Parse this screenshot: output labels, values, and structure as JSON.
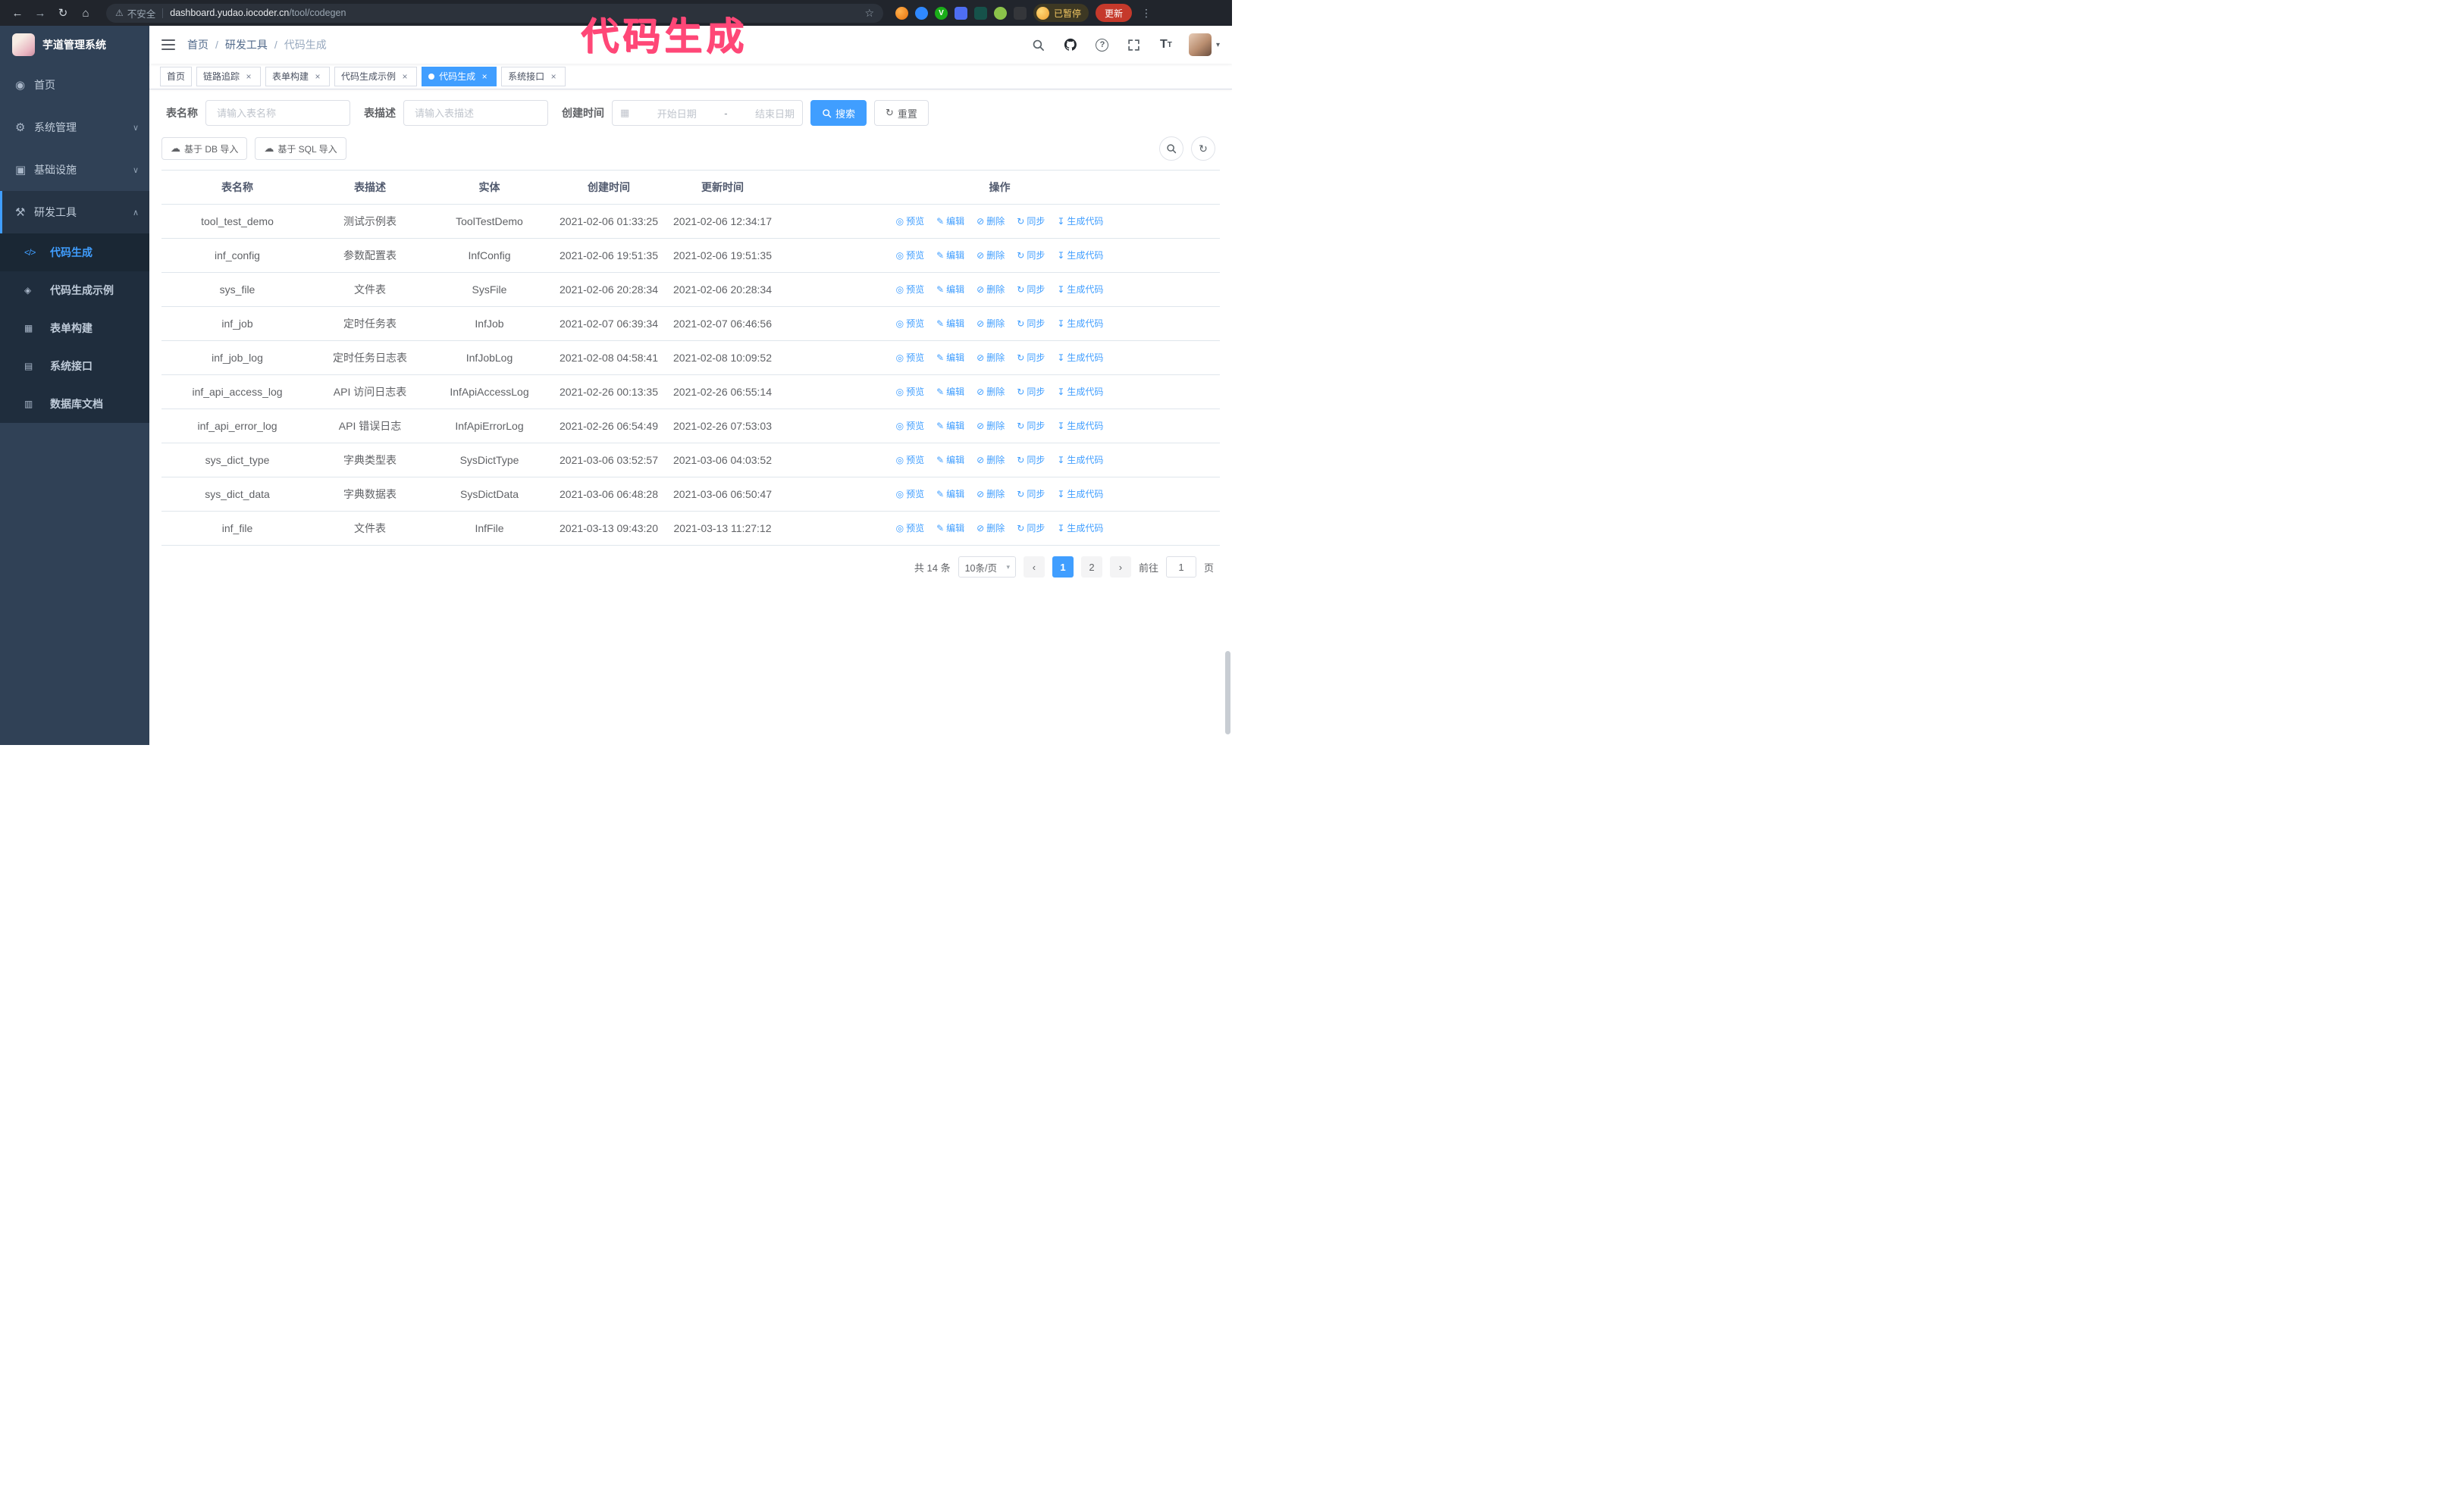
{
  "annotation": {
    "text": "代码生成"
  },
  "browser": {
    "warning_label": "不安全",
    "url_host": "dashboard.yudao.iocoder.cn",
    "url_path": "/tool/codegen",
    "paused_label": "已暂停",
    "update_label": "更新"
  },
  "icons": {
    "back": "←",
    "forward": "→",
    "reload": "↻",
    "home": "⌂",
    "warning": "⚠",
    "star": "☆",
    "close": "×",
    "help": "?",
    "caret": "▾",
    "dots": "⋮",
    "font_t": "T",
    "menu_home": "◉",
    "menu_system": "⚙",
    "menu_infra": "▣",
    "menu_dev": "⚒",
    "sub_codegen": "</>",
    "sub_example": "◈",
    "sub_form": "▦",
    "sub_api": "▤",
    "sub_db": "▥",
    "chevron_down": "∨",
    "chevron_up": "∧",
    "calendar": "▦",
    "refresh": "↻",
    "upload": "☁",
    "eye": "◎",
    "edit": "✎",
    "delete": "⊘",
    "sync": "↻",
    "download": "↧",
    "prev": "‹",
    "next": "›",
    "ext_v": "V"
  },
  "sidebar": {
    "logo_title": "芋道管理系统",
    "menu": [
      {
        "label": "首页"
      },
      {
        "label": "系统管理"
      },
      {
        "label": "基础设施"
      },
      {
        "label": "研发工具"
      }
    ],
    "submenu": [
      {
        "label": "代码生成"
      },
      {
        "label": "代码生成示例"
      },
      {
        "label": "表单构建"
      },
      {
        "label": "系统接口"
      },
      {
        "label": "数据库文档"
      }
    ]
  },
  "breadcrumb": {
    "separator": "/",
    "items": [
      "首页",
      "研发工具",
      "代码生成"
    ]
  },
  "tabs": [
    {
      "label": "首页"
    },
    {
      "label": "链路追踪"
    },
    {
      "label": "表单构建"
    },
    {
      "label": "代码生成示例"
    },
    {
      "label": "代码生成"
    },
    {
      "label": "系统接口"
    }
  ],
  "filters": {
    "name_label": "表名称",
    "name_placeholder": "请输入表名称",
    "desc_label": "表描述",
    "desc_placeholder": "请输入表描述",
    "time_label": "创建时间",
    "start_placeholder": "开始日期",
    "range_separator": "-",
    "end_placeholder": "结束日期",
    "search_label": "搜索",
    "reset_label": "重置"
  },
  "toolbar": {
    "import_db_label": "基于 DB 导入",
    "import_sql_label": "基于 SQL 导入"
  },
  "table": {
    "columns": [
      "表名称",
      "表描述",
      "实体",
      "创建时间",
      "更新时间",
      "操作"
    ],
    "actions": [
      "预览",
      "编辑",
      "删除",
      "同步",
      "生成代码"
    ],
    "rows": [
      {
        "name": "tool_test_demo",
        "desc": "测试示例表",
        "entity": "ToolTestDemo",
        "created": "2021-02-06 01:33:25",
        "updated": "2021-02-06 12:34:17"
      },
      {
        "name": "inf_config",
        "desc": "参数配置表",
        "entity": "InfConfig",
        "created": "2021-02-06 19:51:35",
        "updated": "2021-02-06 19:51:35"
      },
      {
        "name": "sys_file",
        "desc": "文件表",
        "entity": "SysFile",
        "created": "2021-02-06 20:28:34",
        "updated": "2021-02-06 20:28:34"
      },
      {
        "name": "inf_job",
        "desc": "定时任务表",
        "entity": "InfJob",
        "created": "2021-02-07 06:39:34",
        "updated": "2021-02-07 06:46:56"
      },
      {
        "name": "inf_job_log",
        "desc": "定时任务日志表",
        "entity": "InfJobLog",
        "created": "2021-02-08 04:58:41",
        "updated": "2021-02-08 10:09:52"
      },
      {
        "name": "inf_api_access_log",
        "desc": "API 访问日志表",
        "entity": "InfApiAccessLog",
        "created": "2021-02-26 00:13:35",
        "updated": "2021-02-26 06:55:14"
      },
      {
        "name": "inf_api_error_log",
        "desc": "API 错误日志",
        "entity": "InfApiErrorLog",
        "created": "2021-02-26 06:54:49",
        "updated": "2021-02-26 07:53:03"
      },
      {
        "name": "sys_dict_type",
        "desc": "字典类型表",
        "entity": "SysDictType",
        "created": "2021-03-06 03:52:57",
        "updated": "2021-03-06 04:03:52"
      },
      {
        "name": "sys_dict_data",
        "desc": "字典数据表",
        "entity": "SysDictData",
        "created": "2021-03-06 06:48:28",
        "updated": "2021-03-06 06:50:47"
      },
      {
        "name": "inf_file",
        "desc": "文件表",
        "entity": "InfFile",
        "created": "2021-03-13 09:43:20",
        "updated": "2021-03-13 11:27:12"
      }
    ]
  },
  "pagination": {
    "total_label": "共 14 条",
    "page_size_label": "10条/页",
    "pages": [
      "1",
      "2"
    ],
    "goto_label": "前往",
    "goto_value": "1",
    "page_unit": "页"
  }
}
